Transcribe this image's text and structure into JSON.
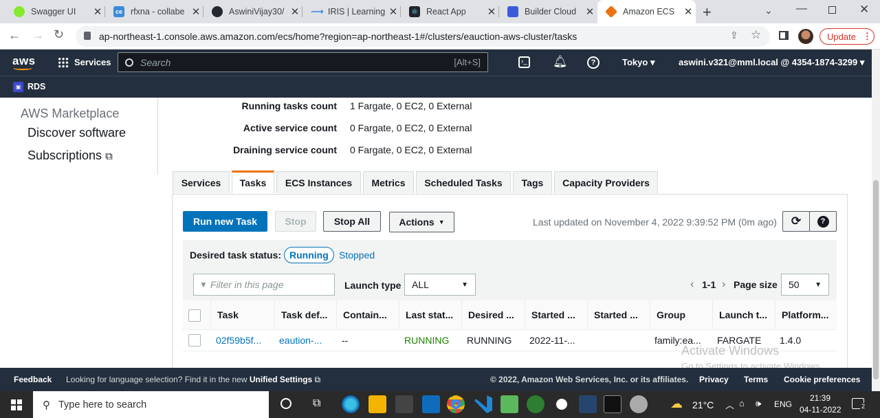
{
  "browser": {
    "tabs": [
      {
        "title": "Swagger UI",
        "icon_color": "#85ea2d"
      },
      {
        "title": "rfxna - collabe",
        "icon_color": "#3c8bd9"
      },
      {
        "title": "AswiniVijay30/",
        "icon_color": "#24292f"
      },
      {
        "title": "IRIS | Learning",
        "icon_color": "#1a73e8"
      },
      {
        "title": "React App",
        "icon_color": "#20232a"
      },
      {
        "title": "Builder Cloud",
        "icon_color": "#3b5bdb"
      },
      {
        "title": "Amazon ECS",
        "icon_color": "#ec7211"
      }
    ],
    "url": "ap-northeast-1.console.aws.amazon.com/ecs/home?region=ap-northeast-1#/clusters/eauction-aws-cluster/tasks",
    "update_label": "Update"
  },
  "aws": {
    "logo": "aws",
    "services_label": "Services",
    "search_placeholder": "Search",
    "search_shortcut": "[Alt+S]",
    "region": "Tokyo",
    "account": "aswini.v321@mml.local @ 4354-1874-3299",
    "rds_label": "RDS"
  },
  "sidebar": {
    "section": "AWS Marketplace",
    "items": [
      "Discover software",
      "Subscriptions"
    ]
  },
  "details": [
    {
      "label": "Running tasks count",
      "value": "1 Fargate, 0 EC2, 0 External"
    },
    {
      "label": "Active service count",
      "value": "0 Fargate, 0 EC2, 0 External"
    },
    {
      "label": "Draining service count",
      "value": "0 Fargate, 0 EC2, 0 External"
    }
  ],
  "tabs": [
    "Services",
    "Tasks",
    "ECS Instances",
    "Metrics",
    "Scheduled Tasks",
    "Tags",
    "Capacity Providers"
  ],
  "toolbar": {
    "run_new_task": "Run new Task",
    "stop": "Stop",
    "stop_all": "Stop All",
    "actions": "Actions",
    "last_updated": "Last updated on November 4, 2022 9:39:52 PM (0m ago)"
  },
  "filters": {
    "desired_status_label": "Desired task status:",
    "running": "Running",
    "stopped": "Stopped",
    "filter_placeholder": "Filter in this page",
    "launch_type_label": "Launch type",
    "launch_type_value": "ALL",
    "pagination": "1-1",
    "page_size_label": "Page size",
    "page_size_value": "50"
  },
  "table": {
    "columns": [
      "Task",
      "Task def...",
      "Contain...",
      "Last stat...",
      "Desired ...",
      "Started ...",
      "Started ...",
      "Group",
      "Launch t...",
      "Platform..."
    ],
    "rows": [
      [
        "02f59b5f...",
        "eaution-...",
        "--",
        "RUNNING",
        "RUNNING",
        "2022-11-...",
        "",
        "family:ea...",
        "FARGATE",
        "1.4.0"
      ]
    ]
  },
  "watermark": {
    "line1": "Activate Windows",
    "line2": "Go to Settings to activate Windows."
  },
  "footer": {
    "feedback": "Feedback",
    "language_text": "Looking for language selection? Find it in the new",
    "unified_settings": "Unified Settings",
    "copyright": "© 2022, Amazon Web Services, Inc. or its affiliates.",
    "privacy": "Privacy",
    "terms": "Terms",
    "cookie": "Cookie preferences"
  },
  "taskbar": {
    "search_placeholder": "Type here to search",
    "temperature": "21°C",
    "language": "ENG",
    "time": "21:39",
    "date": "04-11-2022",
    "notification_count": "2"
  }
}
